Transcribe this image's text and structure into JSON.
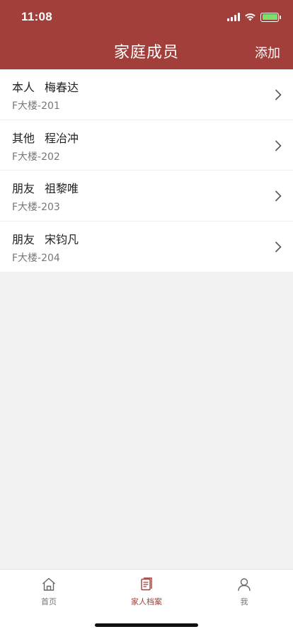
{
  "status_bar": {
    "time": "11:08"
  },
  "nav": {
    "title": "家庭成员",
    "add_label": "添加"
  },
  "members": [
    {
      "relation": "本人",
      "name": "梅春达",
      "address": "F大楼-201"
    },
    {
      "relation": "其他",
      "name": "程冶冲",
      "address": "F大楼-202"
    },
    {
      "relation": "朋友",
      "name": "祖黎唯",
      "address": "F大楼-203"
    },
    {
      "relation": "朋友",
      "name": "宋钧凡",
      "address": "F大楼-204"
    }
  ],
  "tabbar": {
    "items": [
      {
        "label": "首页",
        "icon": "home-icon"
      },
      {
        "label": "家人档案",
        "icon": "document-icon",
        "active": true
      },
      {
        "label": "我",
        "icon": "person-icon"
      }
    ]
  },
  "colors": {
    "brand": "#a23f3a",
    "background": "#f2f2f2"
  }
}
